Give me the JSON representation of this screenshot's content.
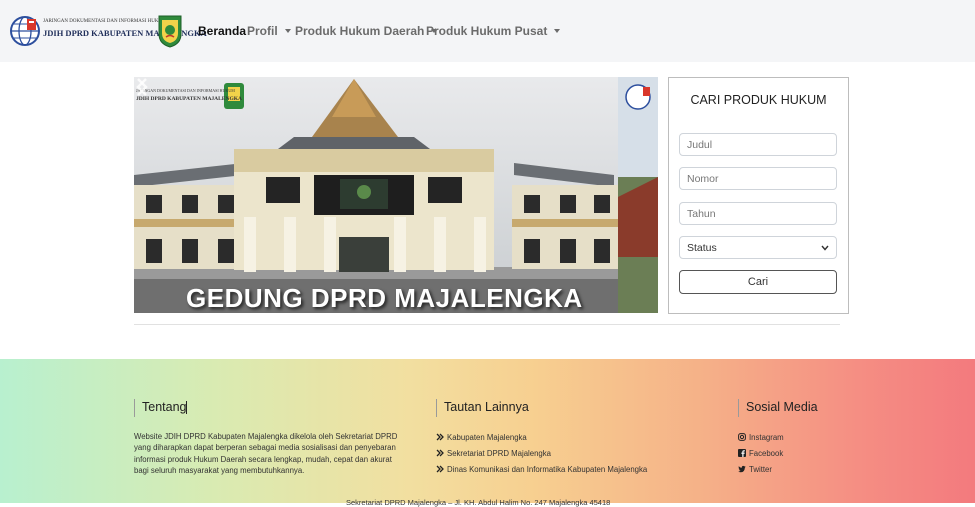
{
  "logo": {
    "line1": "JARINGAN DOKUMENTASI DAN INFORMASI HUKUM",
    "line2": "JDIH DPRD KABUPATEN MAJALENGKA"
  },
  "nav": {
    "items": [
      {
        "label": "Beranda",
        "active": true,
        "dropdown": false
      },
      {
        "label": "Profil",
        "active": false,
        "dropdown": true
      },
      {
        "label": "Produk Hukum Daerah",
        "active": false,
        "dropdown": true
      },
      {
        "label": "Produk Hukum Pusat",
        "active": false,
        "dropdown": true
      }
    ]
  },
  "carousel": {
    "caption": "GEDUNG DPRD MAJALENGKA",
    "logo_line1": "JARINGAN DOKUMENTASI DAN INFORMASI HUKUM",
    "logo_line2": "JDIH DPRD KABUPATEN MAJALENGKA"
  },
  "search": {
    "title": "CARI PRODUK HUKUM",
    "judul_placeholder": "Judul",
    "nomor_placeholder": "Nomor",
    "tahun_placeholder": "Tahun",
    "status_value": "Status",
    "button_label": "Cari"
  },
  "footer": {
    "about_title": "Tentang",
    "about_text": "Website JDIH DPRD Kabupaten Majalengka dikelola oleh Sekretariat DPRD yang diharapkan dapat berperan sebagai media sosialisasi dan penyebaran informasi produk Hukum Daerah secara lengkap, mudah, cepat dan akurat bagi seluruh masyarakat yang membutuhkannya.",
    "links_title": "Tautan Lainnya",
    "links": [
      "Kabupaten Majalengka",
      "Sekretariat DPRD Majalengka",
      "Dinas Komunikasi dan Informatika Kabupaten Majalengka"
    ],
    "social_title": "Sosial Media",
    "social": [
      {
        "label": "Instagram",
        "icon": "instagram-icon"
      },
      {
        "label": "Facebook",
        "icon": "facebook-icon"
      },
      {
        "label": "Twitter",
        "icon": "twitter-icon"
      }
    ],
    "bottom_text": "Sekretariat DPRD Majalengka – Jl. KH. Abdul Halim No. 247 Majalengka 45418"
  },
  "colors": {
    "navbar_bg": "#f4f5f7",
    "footer_gradient": [
      "#b8f0cf",
      "#f2dfa0",
      "#f37a7e"
    ]
  }
}
